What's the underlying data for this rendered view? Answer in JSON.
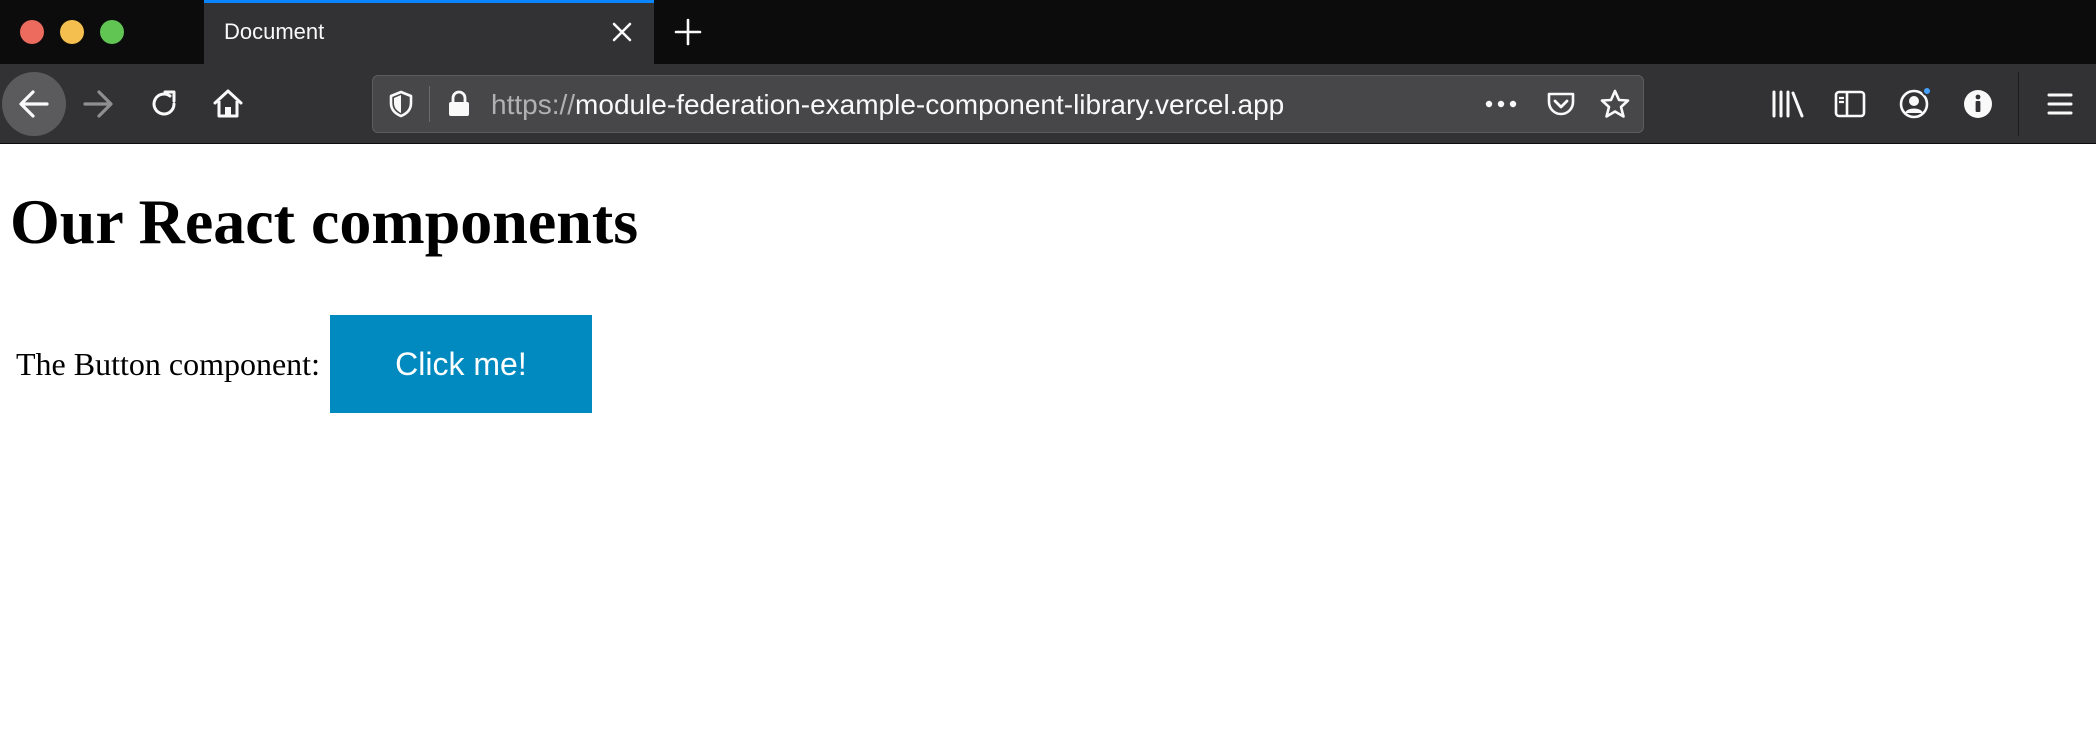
{
  "browser": {
    "tab": {
      "title": "Document"
    },
    "url": {
      "scheme": "https://",
      "host": "module-federation-example-component-library.vercel.app"
    },
    "colors": {
      "accent": "#0a84ff",
      "notification": "#45a1ff"
    }
  },
  "page": {
    "title": "Our React components",
    "button_row": {
      "label": "The Button component:",
      "button_label": "Click me!",
      "button_color": "#008ac0"
    }
  }
}
